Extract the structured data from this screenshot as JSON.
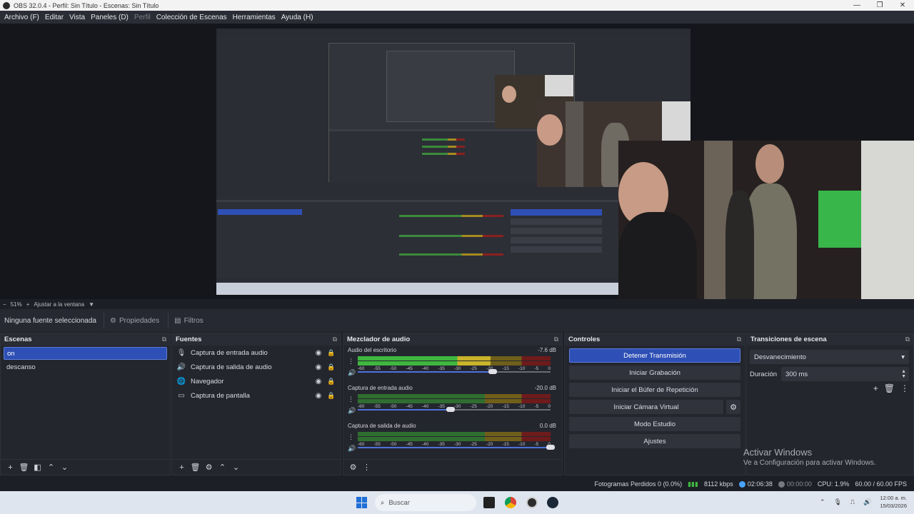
{
  "window": {
    "title": "OBS 32.0.4 - Perfil: Sin Título - Escenas: Sin Título",
    "controls": [
      "—",
      "❐",
      "✕"
    ]
  },
  "menubar": {
    "items": [
      "Archivo (F)",
      "Editar",
      "Vista",
      "Paneles (D)",
      "Perfil",
      "Colección de Escenas",
      "Herramientas",
      "Ayuda (H)"
    ]
  },
  "preview": {
    "zoom": "51%",
    "fit_label": "Ajustar a la ventana"
  },
  "source_toolbar": {
    "no_source": "Ninguna fuente seleccionada",
    "properties": "Propiedades",
    "filters": "Filtros"
  },
  "scenes": {
    "title": "Escenas",
    "items": [
      "on",
      "descanso"
    ],
    "selected": "on"
  },
  "sources": {
    "title": "Fuentes",
    "items": [
      {
        "label": "Captura de entrada audio",
        "icon": "microphone-icon"
      },
      {
        "label": "Captura de salida de audio",
        "icon": "speaker-icon"
      },
      {
        "label": "Navegador",
        "icon": "globe-icon"
      },
      {
        "label": "Captura de pantalla",
        "icon": "monitor-icon"
      }
    ]
  },
  "mixer": {
    "title": "Mezclador de audio",
    "scale": [
      "-60",
      "-55",
      "-50",
      "-45",
      "-40",
      "-35",
      "-30",
      "-25",
      "-20",
      "-15",
      "-10",
      "-5",
      "0"
    ],
    "tracks": [
      {
        "name": "Audio del escritorio",
        "db": "-7.6 dB",
        "level": 0.69,
        "volume": 0.7
      },
      {
        "name": "Captura de entrada audio",
        "db": "-20.0 dB",
        "level": 0.0,
        "volume": 0.48
      },
      {
        "name": "Captura de salida de audio",
        "db": "0.0 dB",
        "level": 0.0,
        "volume": 1.0
      }
    ]
  },
  "controls": {
    "title": "Controles",
    "stop_stream": "Detener Transmisión",
    "start_recording": "Iniciar Grabación",
    "replay_buffer": "Iniciar el Búfer de Repetición",
    "virtual_camera": "Iniciar Cámara Virtual",
    "studio_mode": "Modo Estudio",
    "settings": "Ajustes"
  },
  "transitions": {
    "title": "Transiciones de escena",
    "selected": "Desvanecimiento",
    "duration_label": "Duración",
    "duration_value": "300 ms"
  },
  "watermark": {
    "line1": "Activar Windows",
    "line2": "Ve a Configuración para activar Windows."
  },
  "status": {
    "dropped_frames": "Fotogramas Perdidos 0 (0.0%)",
    "bitrate": "8112 kbps",
    "stream_time": "02:06:38",
    "record_time": "00:00:00",
    "cpu": "CPU: 1.9%",
    "fps": "60.00 / 60.00 FPS",
    "colors": {
      "live": "#4aa3ff",
      "record": "#777a82",
      "signal": "#3fb73f"
    }
  },
  "taskbar": {
    "search_placeholder": "Buscar",
    "time": "12:00 a. m.",
    "date": "15/03/2026"
  },
  "colors": {
    "accent": "#2e4fb5",
    "panel": "#24262e",
    "background": "#1d1f26"
  }
}
